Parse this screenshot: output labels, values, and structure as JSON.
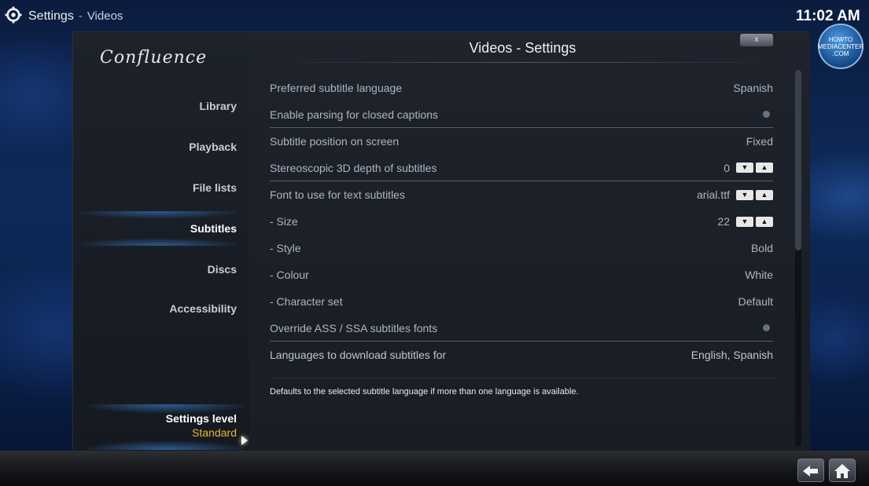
{
  "header": {
    "breadcrumb_root": "Settings",
    "breadcrumb_separator": "-",
    "breadcrumb_section": "Videos",
    "clock": "11:02 AM",
    "badge_line1": "HOWTO",
    "badge_line2": "MEDIACENTER",
    "badge_line3": ".COM"
  },
  "sidebar": {
    "brand": "Confluence",
    "items": [
      {
        "label": "Library"
      },
      {
        "label": "Playback"
      },
      {
        "label": "File lists"
      },
      {
        "label": "Subtitles"
      },
      {
        "label": "Discs"
      },
      {
        "label": "Accessibility"
      }
    ],
    "active_index": 3,
    "settings_level_label": "Settings level",
    "settings_level_value": "Standard"
  },
  "dialog": {
    "title": "Videos - Settings",
    "close_label": "x"
  },
  "settings": [
    {
      "label": "Preferred subtitle language",
      "value": "Spanish"
    },
    {
      "label": "Enable parsing for closed captions",
      "value": ""
    },
    {
      "label": "Subtitle position on screen",
      "value": "Fixed"
    },
    {
      "label": "Stereoscopic 3D depth of subtitles",
      "value": "0"
    },
    {
      "label": "Font to use for text subtitles",
      "value": "arial.ttf"
    },
    {
      "label": "- Size",
      "value": "22"
    },
    {
      "label": "- Style",
      "value": "Bold"
    },
    {
      "label": "- Colour",
      "value": "White"
    },
    {
      "label": "- Character set",
      "value": "Default"
    },
    {
      "label": "Override ASS / SSA subtitles fonts",
      "value": ""
    },
    {
      "label": "Languages to download subtitles for",
      "value": "English, Spanish"
    }
  ],
  "description": "Defaults to the selected subtitle language if more than one language is available.",
  "spinner": {
    "down": "▼",
    "up": "▲"
  },
  "colors": {
    "accent_blue": "#3c8ce6",
    "level_value": "#e8b63a"
  }
}
